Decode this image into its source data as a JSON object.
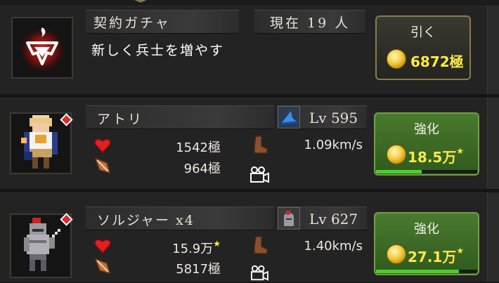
{
  "gacha": {
    "title": "契約ガチャ",
    "count_label": "現在 19 人",
    "subtitle": "新しく兵士を増やす",
    "button_label": "引く",
    "price": "6872極",
    "icon": "red-emblem-icon"
  },
  "units": [
    {
      "name": "アトリ",
      "level": "Lv 595",
      "level_icon": "blue-hat-icon",
      "hp": "1542極",
      "attack": "964極",
      "speed": "1.09km/s",
      "upgrade_label": "強化",
      "upgrade_price": "18.5万",
      "upgrade_progress": 0.45
    },
    {
      "name": "ソルジャー x4",
      "level": "Lv 627",
      "level_icon": "red-helmet-icon",
      "hp": "15.9万",
      "hp_star": "★",
      "attack": "5817極",
      "speed": "1.40km/s",
      "upgrade_label": "強化",
      "upgrade_price": "27.1万",
      "upgrade_progress": 0.82
    }
  ],
  "colors": {
    "accent_gold": "#ffe84a",
    "button_green": "#3f6e26",
    "badge_red": "#e02a2a"
  }
}
